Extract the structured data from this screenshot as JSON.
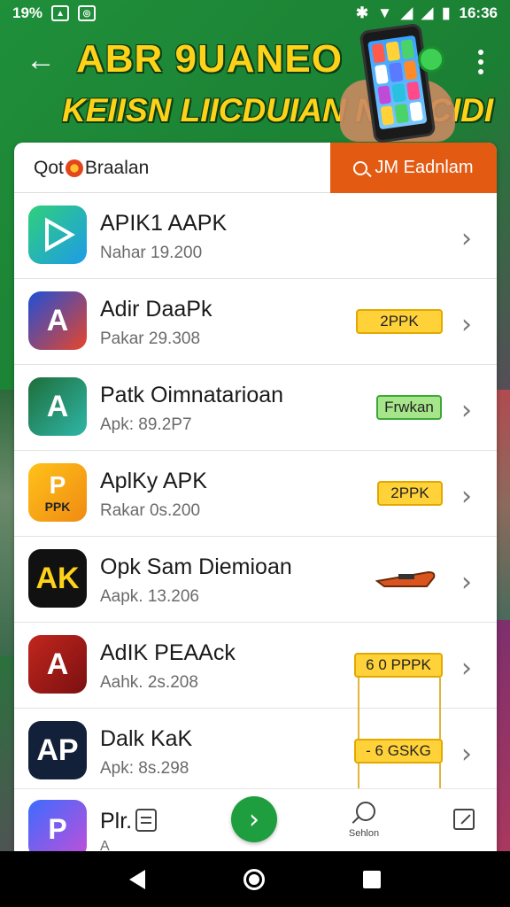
{
  "status_bar": {
    "left_text": "19%",
    "right_text": "16:36"
  },
  "header": {
    "title_line1": "ABR 9UANEO",
    "title_line2": "KEIISN LIICDUIAN NDOCIDI"
  },
  "tabs": {
    "brand_prefix": "Qot",
    "brand_suffix": "Braalan",
    "search_label": "JM Eadnlam"
  },
  "apps": [
    {
      "name": "APIK1 AAPK",
      "sub": "Nahar 19.200",
      "badge": ""
    },
    {
      "name": "Adir DaaPk",
      "sub": "Pakar 29.308",
      "badge": "2PPK"
    },
    {
      "name": "Patk Oimnatarioan",
      "sub": "Apk: 89.2P7",
      "badge": "Frwkan"
    },
    {
      "name": "AplKy APK",
      "sub": "Rakar 0s.200",
      "badge": "2PPK",
      "icon_text": "PPK"
    },
    {
      "name": "Opk Sam Diemioan",
      "sub": "Aapk. 13.206",
      "badge": ""
    },
    {
      "name": "AdIK PEAAck",
      "sub": "Aahk. 2s.208",
      "badge": "6 0 PPPK"
    },
    {
      "name": "Dalk KaK",
      "sub": "Apk: 8s.298",
      "badge": "- 6 GSKG"
    }
  ],
  "bottom_bar": {
    "partial_app_name": "Plr.",
    "partial_app_sub": "A",
    "search_label": "Sehlon"
  },
  "colors": {
    "accent": "#e35a13",
    "fab": "#1e9e3e",
    "title_yellow": "#ffd21a",
    "badge_yellow": "#ffd23a",
    "badge_green": "#a6e58a"
  },
  "icons": {
    "back": "arrow-left-icon",
    "more": "more-vert-icon",
    "search": "search-icon",
    "chevron": "chevron-right-icon"
  }
}
